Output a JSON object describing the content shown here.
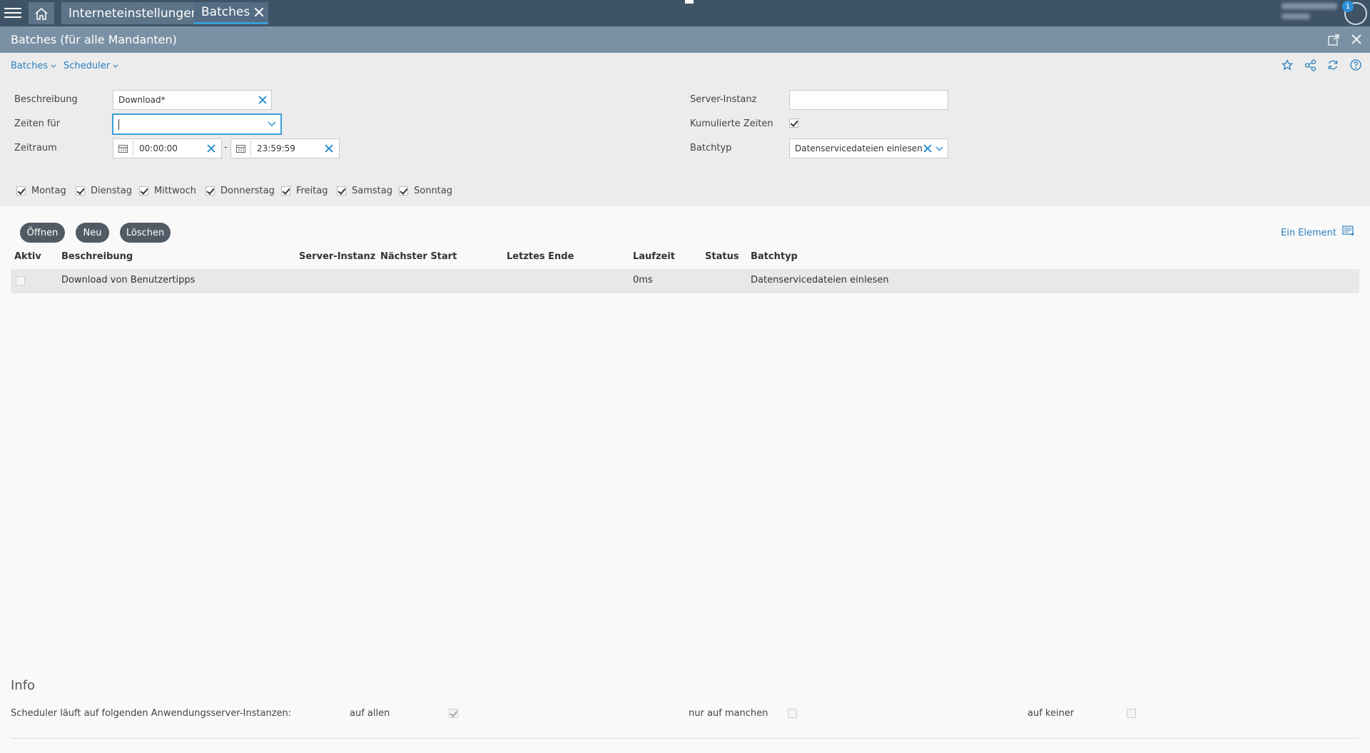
{
  "tabs": [
    {
      "label": "Interneteinstellungen",
      "active": false
    },
    {
      "label": "Batches",
      "active": true
    }
  ],
  "header": {
    "notification_count": "1"
  },
  "view": {
    "title": "Batches (für alle Mandanten)"
  },
  "toolbar": {
    "menus": [
      "Batches",
      "Scheduler"
    ],
    "icons": [
      "star-icon",
      "share-icon",
      "refresh-icon",
      "help-icon"
    ]
  },
  "filter": {
    "beschreibung": {
      "label": "Beschreibung",
      "value": "Download*"
    },
    "zeiten_fuer": {
      "label": "Zeiten für",
      "value": ""
    },
    "zeitraum": {
      "label": "Zeitraum",
      "from": "00:00:00",
      "separator": "-",
      "to": "23:59:59"
    },
    "server_instanz": {
      "label": "Server-Instanz",
      "value": ""
    },
    "kumulierte_zeiten": {
      "label": "Kumulierte Zeiten",
      "checked": true
    },
    "batchtyp": {
      "label": "Batchtyp",
      "value": "Datenservicedateien einlesen"
    },
    "days": [
      {
        "label": "Montag",
        "checked": true
      },
      {
        "label": "Dienstag",
        "checked": true
      },
      {
        "label": "Mittwoch",
        "checked": true
      },
      {
        "label": "Donnerstag",
        "checked": true
      },
      {
        "label": "Freitag",
        "checked": true
      },
      {
        "label": "Samstag",
        "checked": true
      },
      {
        "label": "Sonntag",
        "checked": true
      }
    ]
  },
  "actions": {
    "open": "Öffnen",
    "new": "Neu",
    "delete": "Löschen",
    "count": "Ein Element"
  },
  "table": {
    "columns": [
      "Aktiv",
      "Beschreibung",
      "Server-Instanz",
      "Nächster Start",
      "Letztes Ende",
      "Laufzeit",
      "Status",
      "Batchtyp"
    ],
    "rows": [
      {
        "aktiv": false,
        "beschreibung": "Download von Benutzertipps",
        "server_instanz": "",
        "naechster_start": "",
        "letztes_ende": "",
        "laufzeit": "0ms",
        "status": "",
        "batchtyp": "Datenservicedateien einlesen"
      }
    ]
  },
  "info": {
    "title": "Info",
    "scheduler_label": "Scheduler läuft auf folgenden Anwendungsserver-Instanzen:",
    "options": [
      {
        "label": "auf allen",
        "checked": true
      },
      {
        "label": "nur auf manchen",
        "checked": false
      },
      {
        "label": "auf keiner",
        "checked": false
      }
    ]
  },
  "colors": {
    "topbar": "#3e5366",
    "titlebar": "#7a91a5",
    "accent": "#2a7fc0",
    "pill_button": "#515b66"
  }
}
